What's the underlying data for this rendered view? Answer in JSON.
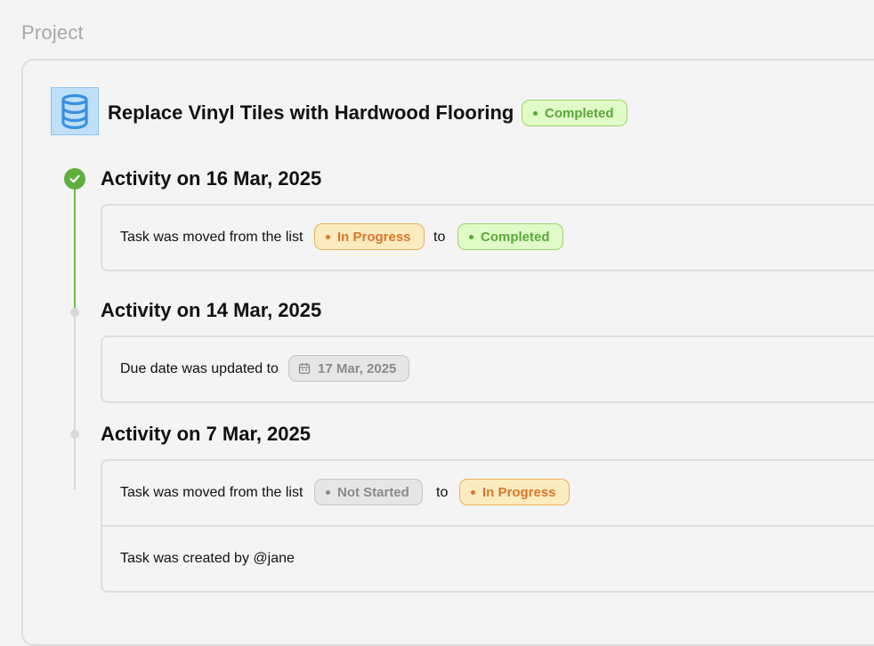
{
  "section_label": "Project",
  "project": {
    "title": "Replace Vinyl Tiles with Hardwood Flooring",
    "status": "Completed",
    "icon": "database-icon"
  },
  "activities": [
    {
      "heading": "Activity on 16 Mar, 2025",
      "entries": [
        {
          "text": "Task was moved from the list",
          "from": "In Progress",
          "connector": "to",
          "to": "Completed"
        }
      ]
    },
    {
      "heading": "Activity on 14 Mar, 2025",
      "entries": [
        {
          "text": "Due date was updated to",
          "date": "17 Mar, 2025"
        }
      ]
    },
    {
      "heading": "Activity on 7 Mar, 2025",
      "entries": [
        {
          "text": "Task was moved from the list",
          "from": "Not Started",
          "connector": "to",
          "to": "In Progress"
        },
        {
          "text": "Task was created by @jane"
        }
      ]
    }
  ],
  "colors": {
    "completed": "#5aa83a",
    "in_progress": "#d9762b",
    "not_started": "#8a8a8a",
    "timeline_done": "#6cbf46"
  }
}
